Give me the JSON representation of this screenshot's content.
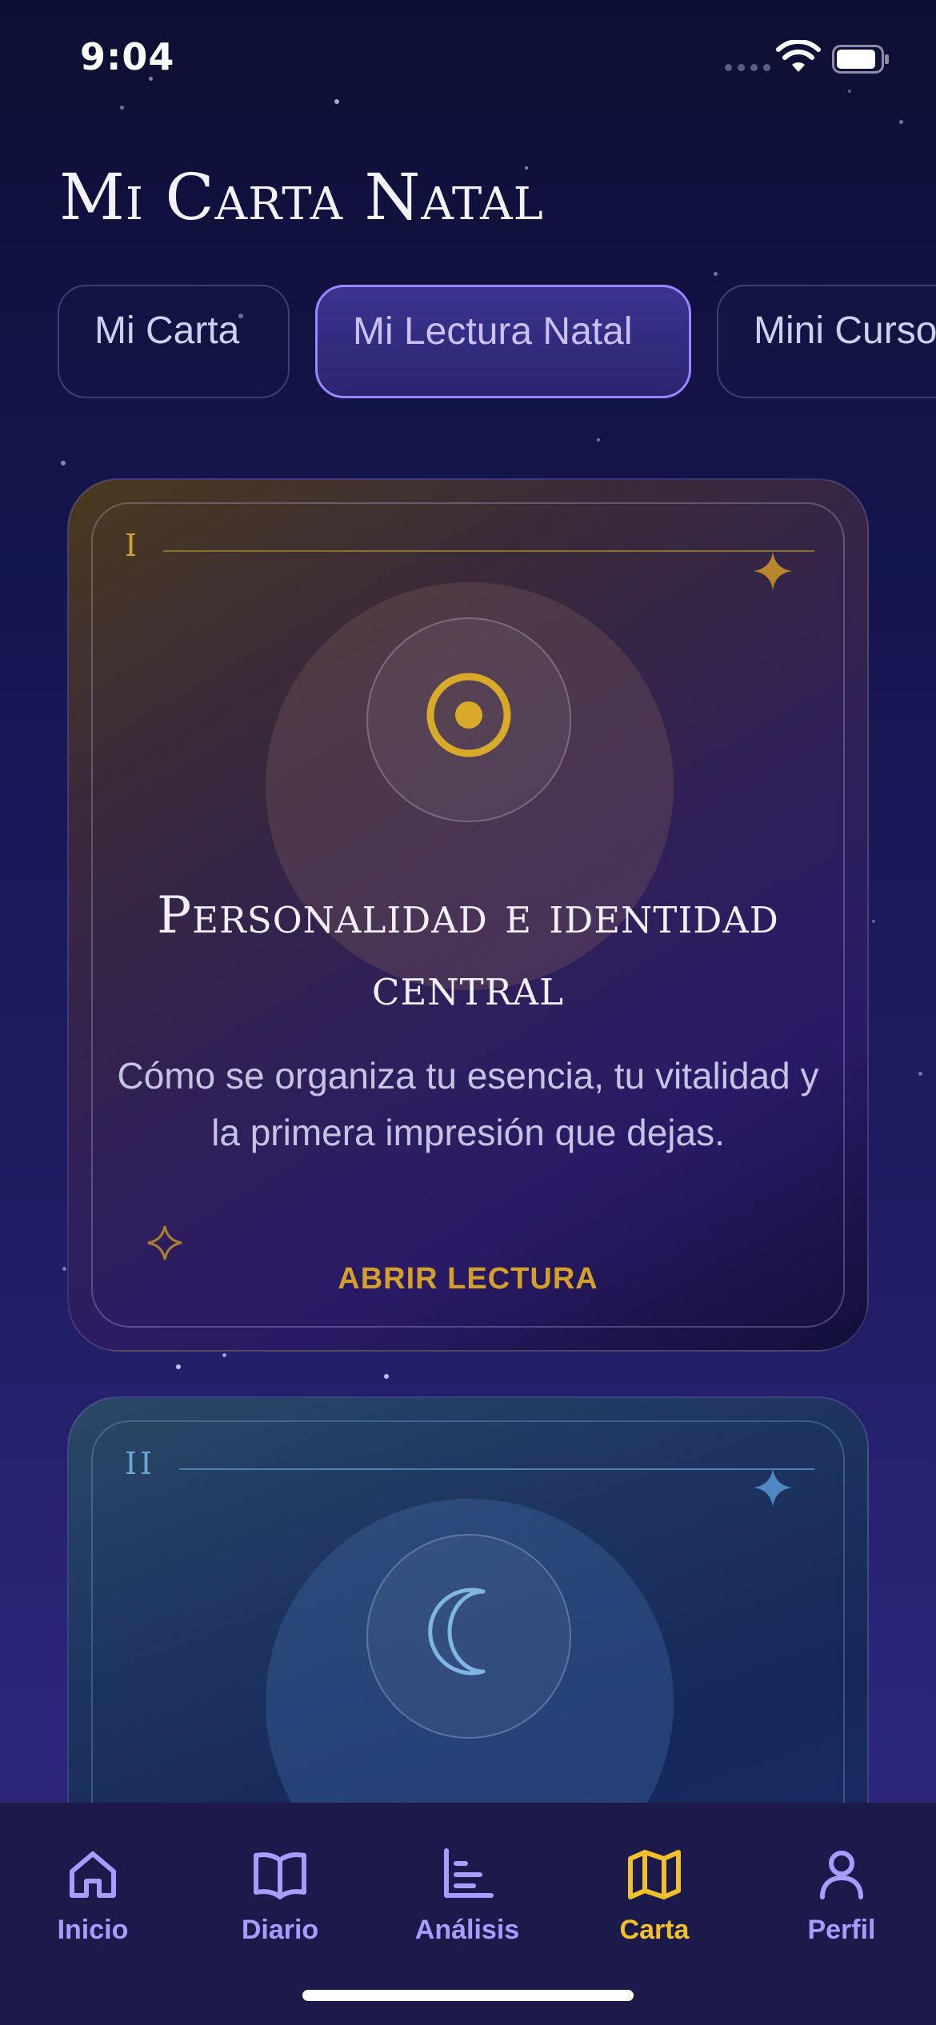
{
  "status_bar": {
    "time": "9:04"
  },
  "page": {
    "title": "Mi Carta Natal"
  },
  "tabs": [
    {
      "label": "Mi Carta",
      "active": false
    },
    {
      "label": "Mi Lectura Natal",
      "active": true
    },
    {
      "label": "Mini Curso",
      "active": false
    }
  ],
  "cards": [
    {
      "numeral": "I",
      "icon": "sun-icon",
      "title": "Personalidad e identidad central",
      "description": "Cómo se organiza tu esencia, tu vitalidad y la primera impresión que dejas.",
      "cta": "ABRIR LECTURA",
      "accent": "#d4a02a"
    },
    {
      "numeral": "II",
      "icon": "moon-icon",
      "accent": "#6fa6d8"
    }
  ],
  "bottom_nav": {
    "items": [
      {
        "label": "Inicio",
        "icon": "home-icon",
        "active": false
      },
      {
        "label": "Diario",
        "icon": "book-icon",
        "active": false
      },
      {
        "label": "Análisis",
        "icon": "chart-icon",
        "active": false
      },
      {
        "label": "Carta",
        "icon": "map-icon",
        "active": true
      },
      {
        "label": "Perfil",
        "icon": "user-icon",
        "active": false
      }
    ],
    "active_color": "#f2c02a",
    "inactive_color": "#a99cff"
  }
}
